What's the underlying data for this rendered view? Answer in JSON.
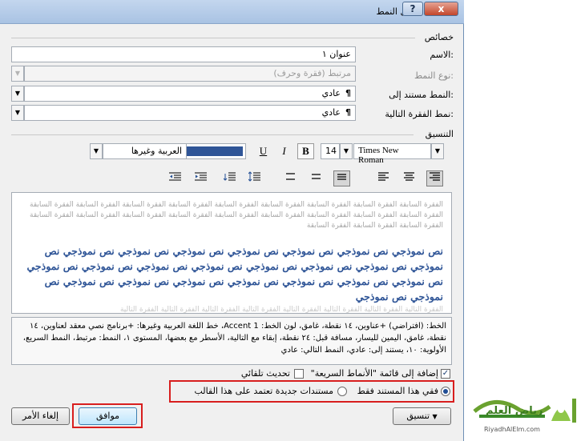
{
  "window": {
    "title": "تعديل النمط",
    "help_label": "?",
    "close_label": "x"
  },
  "properties": {
    "section_label": "خصائص",
    "name_label": "الاسم:",
    "name_value": "عنوان ١",
    "style_type_label": "نوع النمط:",
    "style_type_value": "مرتبط (فقرة وحرف)",
    "based_on_label": "النمط مستند إلى:",
    "based_on_value": "عادي",
    "next_para_label": "نمط الفقرة التالية:",
    "next_para_value": "عادي",
    "para_mark": "¶"
  },
  "formatting": {
    "section_label": "التنسيق",
    "font_name": "Times New Roman",
    "font_size": "14",
    "bold_label": "B",
    "italic_label": "I",
    "underline_label": "U",
    "font_color": "#2f5597",
    "script_value": "العربية",
    "language_value": "وغيرها"
  },
  "preview": {
    "previous_paragraph": "الفقرة السابقة الفقرة السابقة الفقرة السابقة الفقرة السابقة الفقرة السابقة الفقرة السابقة الفقرة السابقة الفقرة السابقة الفقرة السابقة الفقرة السابقة الفقرة السابقة الفقرة السابقة الفقرة السابقة الفقرة السابقة الفقرة السابقة الفقرة السابقة الفقرة السابقة الفقرة السابقة الفقرة السابقة الفقرة السابقة الفقرة السابقة",
    "sample_text": "نص نموذجي نص نموذجي نص نموذجي نص نموذجي نص نموذجي نص نموذجي نص نموذجي نص نموذجي نص نموذجي نص نموذجي نص نموذجي نص نموذجي نص نموذجي نص نموذجي نص نموذجي نص نموذجي نص نموذجي نص نموذجي نص نموذجي نص نموذجي نص نموذجي نص نموذجي نص نموذجي نص نموذجي",
    "next_paragraph": "الفقرة التالية الفقرة التالية الفقرة التالية الفقرة التالية الفقرة التالية الفقرة التالية الفقرة التالية الفقرة التالية"
  },
  "description": "الخط: (افتراضي) +عناوين، ١٤ نقطة، غامق، لون الخط: Accent 1، خط اللغة العربية وغيرها: +برنامج نصي معقد لعناوين، ١٤ نقطة، غامق، اليمين لليسار، مسافة قبل: ٢٤ نقطة، إبقاء مع التالية، الأسطر مع بعضها، المستوى ١، النمط: مرتبط، النمط السريع، الأولوية: ١٠، يستند إلى: عادي، النمط التالي: عادي",
  "options": {
    "add_quick_styles": "إضافة إلى قائمة \"الأنماط السريعة\"",
    "auto_update": "تحديث تلقائي",
    "only_this_document": "فقي هذا المستند فقط",
    "new_documents": "مستندات جديدة تعتمد على هذا القالب"
  },
  "buttons": {
    "format": "تنسيق",
    "ok": "موافق",
    "cancel": "إلغاء الأمر"
  },
  "logo": {
    "site": "RiyadhAlElm.com",
    "name": "رياض العلم"
  },
  "colors": {
    "highlight": "#d81e1e",
    "accent": "#1f4d94"
  }
}
